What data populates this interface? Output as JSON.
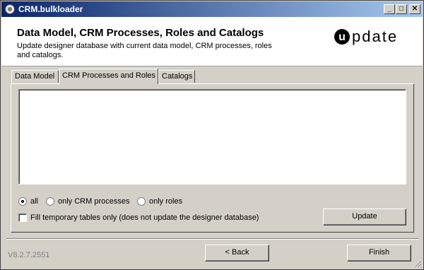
{
  "window": {
    "title": "CRM.bulkloader",
    "controls": [
      "minimize",
      "maximize",
      "close"
    ]
  },
  "header": {
    "title": "Data Model, CRM Processes, Roles and Catalogs",
    "subtitle": "Update designer database with current data model, CRM processes, roles and catalogs.",
    "logo_text": "update"
  },
  "tabs": [
    {
      "label": "Data Model",
      "active": false
    },
    {
      "label": "CRM Processes and Roles",
      "active": true
    },
    {
      "label": "Catalogs",
      "active": false
    }
  ],
  "output_text": "",
  "radios": [
    {
      "label": "all",
      "checked": true
    },
    {
      "label": "only CRM processes",
      "checked": false
    },
    {
      "label": "only roles",
      "checked": false
    }
  ],
  "checkbox": {
    "label": "Fill temporary tables only (does not update the designer database)",
    "checked": false
  },
  "buttons": {
    "update": "Update",
    "back": "< Back",
    "finish": "Finish"
  },
  "footer": {
    "version": "V8.2.7.2551"
  },
  "colors": {
    "titlebar_start": "#0a246a",
    "titlebar_end": "#a6caf0",
    "face": "#d4d0c8"
  }
}
